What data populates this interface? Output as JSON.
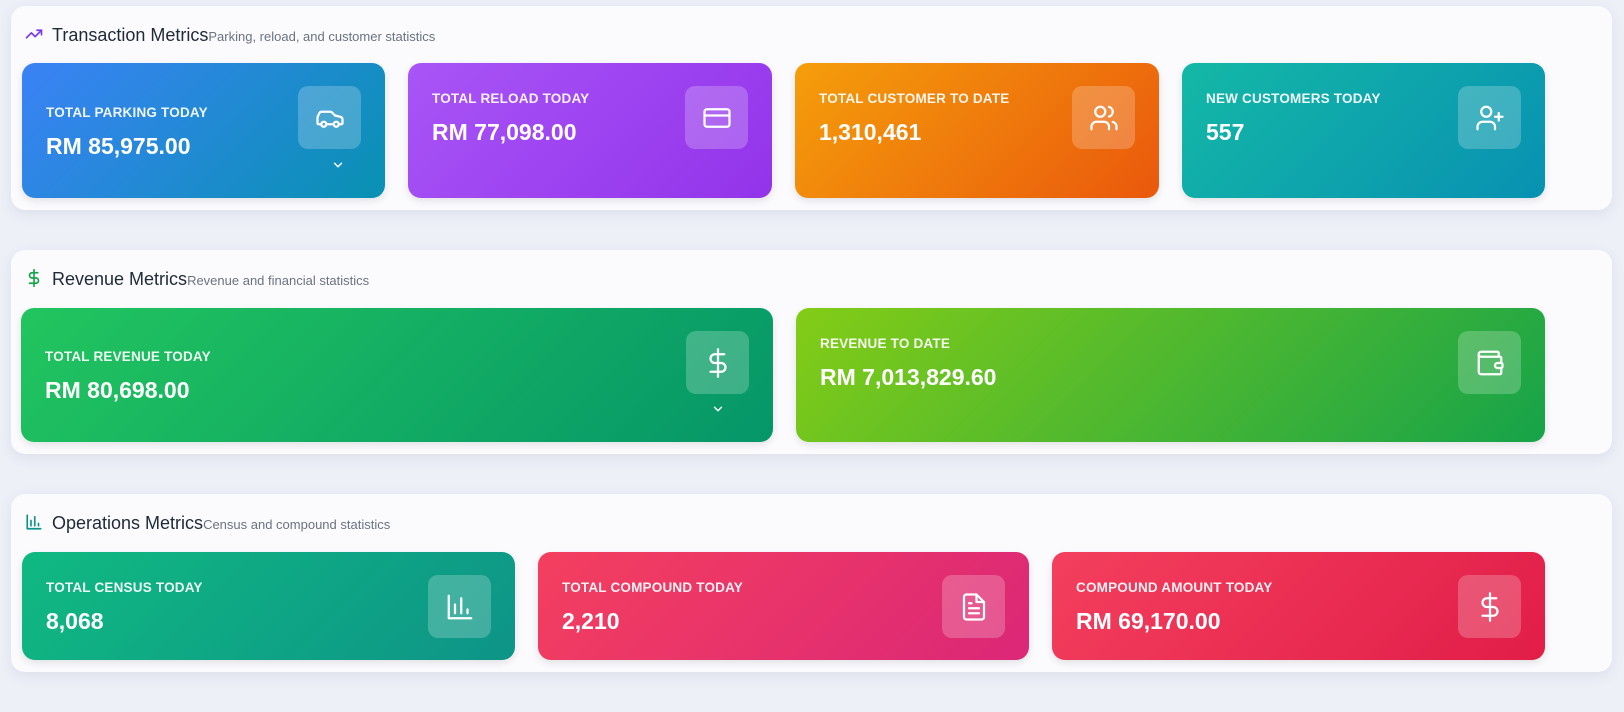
{
  "sections": {
    "transaction": {
      "title": "Transaction Metrics",
      "subtitle": "Parking, reload, and customer statistics",
      "icon": "trending-up-icon",
      "accent": "#7c3aed",
      "cards": [
        {
          "label": "TOTAL PARKING TODAY",
          "value": "RM 85,975.00",
          "icon": "car-icon",
          "expandable": true
        },
        {
          "label": "TOTAL RELOAD TODAY",
          "value": "RM 77,098.00",
          "icon": "credit-card-icon"
        },
        {
          "label": "TOTAL CUSTOMER TO DATE",
          "value": "1,310,461",
          "icon": "users-icon"
        },
        {
          "label": "NEW CUSTOMERS TODAY",
          "value": "557",
          "icon": "user-plus-icon"
        }
      ]
    },
    "revenue": {
      "title": "Revenue Metrics",
      "subtitle": "Revenue and financial statistics",
      "icon": "dollar-sign-icon",
      "accent": "#16a34a",
      "cards": [
        {
          "label": "TOTAL REVENUE TODAY",
          "value": "RM 80,698.00",
          "icon": "dollar-sign-icon",
          "expandable": true
        },
        {
          "label": "REVENUE TO DATE",
          "value": "RM 7,013,829.60",
          "icon": "wallet-icon"
        }
      ]
    },
    "operations": {
      "title": "Operations Metrics",
      "subtitle": "Census and compound statistics",
      "icon": "bar-chart-icon",
      "accent": "#0d9488",
      "cards": [
        {
          "label": "TOTAL CENSUS TODAY",
          "value": "8,068",
          "icon": "bar-chart-icon"
        },
        {
          "label": "TOTAL COMPOUND TODAY",
          "value": "2,210",
          "icon": "file-text-icon"
        },
        {
          "label": "COMPOUND AMOUNT TODAY",
          "value": "RM 69,170.00",
          "icon": "dollar-sign-icon"
        }
      ]
    }
  },
  "colors": {
    "parking": [
      "#3b82f6",
      "#0891b2"
    ],
    "reload": [
      "#a855f7",
      "#9333ea"
    ],
    "customer": [
      "#f59e0b",
      "#ea580c"
    ],
    "new_customers": [
      "#14b8a6",
      "#0891b2"
    ],
    "revenue_today": [
      "#22c55e",
      "#059669"
    ],
    "revenue_to_date": [
      "#84cc16",
      "#16a34a"
    ],
    "census": [
      "#10b981",
      "#0d9488"
    ],
    "compound": [
      "#f43f5e",
      "#db2777"
    ],
    "compound_amount": [
      "#f43f5e",
      "#e11d48"
    ]
  }
}
